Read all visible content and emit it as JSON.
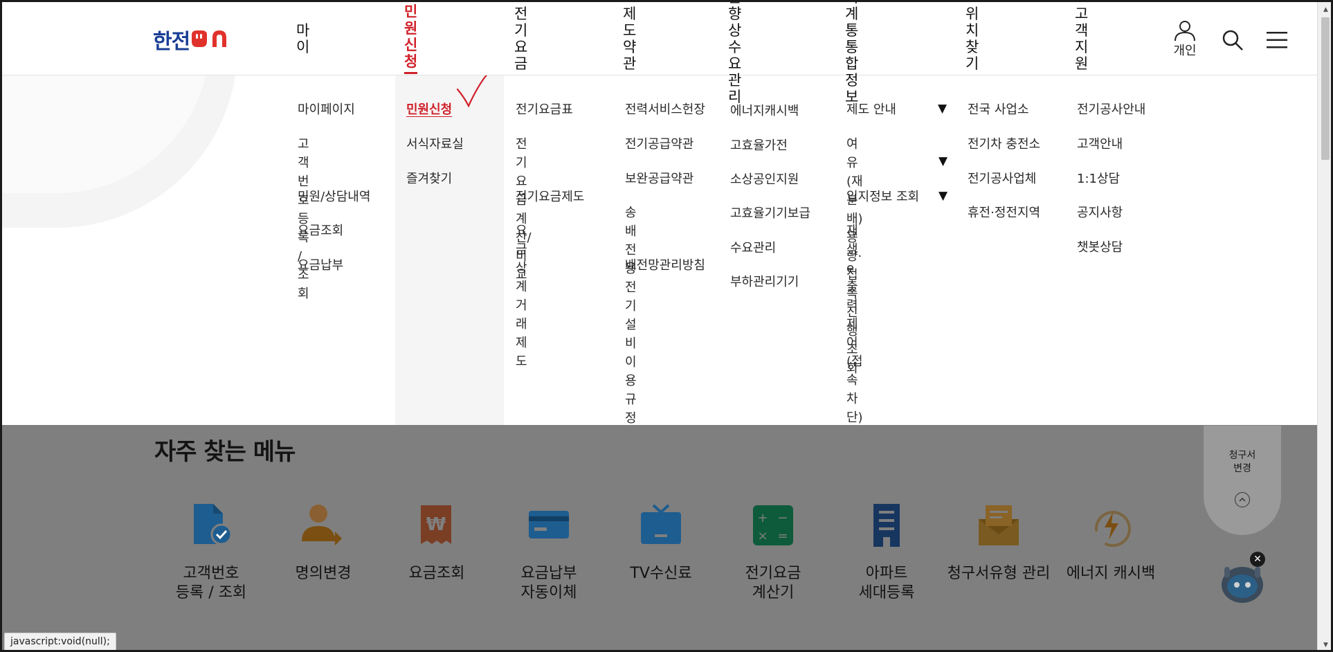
{
  "brand": {
    "logo_text": "한전",
    "logo_on": "ON",
    "colors": {
      "primary": "#1b3f95",
      "accent": "#d0212a",
      "dim": "#7f7f7f"
    }
  },
  "gnb": [
    {
      "label": "마이"
    },
    {
      "label": "민원신청",
      "active": true
    },
    {
      "label": "전기요금"
    },
    {
      "label": "제도약관"
    },
    {
      "label": "효율향상\n수요관리"
    },
    {
      "label": "전력계통\n통합정보"
    },
    {
      "label": "위치찾기"
    },
    {
      "label": "고객지원"
    }
  ],
  "util": {
    "user_label": "개인",
    "user_icon": "person-icon",
    "search_icon": "search-icon",
    "menu_icon": "hamburger-menu-icon"
  },
  "mega_menu": {
    "col_my": [
      "마이페이지",
      "고객번호\n등록 / 조회",
      "민원/상담내역",
      "요금조회",
      "요금납부"
    ],
    "col_apply": [
      "민원신청",
      "서식자료실",
      "즐겨찾기"
    ],
    "col_bill": [
      "전기요금표",
      "전기요금계산/\n비교",
      "전기요금제도",
      "요금 상계거래\n제도"
    ],
    "col_terms": [
      "전력서비스헌장",
      "전기공급약관",
      "보완공급약관",
      "송배전용 전기\n설비 이용규정",
      "배전망관리방침"
    ],
    "col_eff": [
      "에너지캐시백",
      "고효율가전",
      "소상공인지원",
      "고효율기기보급",
      "수요관리",
      "부하관리기기"
    ],
    "col_grid": [
      "제도 안내",
      "여유(재분배)용량·\n접속진행 조회",
      "입지정보 조회",
      "재생e 출력제어\n(접속차단) 현황"
    ],
    "col_loc": [
      "전국 사업소",
      "전기차 충전소",
      "전기공사업체",
      "휴전·정전지역"
    ],
    "col_support": [
      "전기공사안내",
      "고객안내",
      "1:1상담",
      "공지사항",
      "챗봇상담"
    ]
  },
  "frequent": {
    "title": "자주 찾는 메뉴",
    "items": [
      {
        "label": "고객번호\n등록 / 조회",
        "icon": "document-check-icon"
      },
      {
        "label": "명의변경",
        "icon": "person-change-icon"
      },
      {
        "label": "요금조회",
        "icon": "won-receipt-icon"
      },
      {
        "label": "요금납부\n자동이체",
        "icon": "credit-card-icon"
      },
      {
        "label": "TV수신료",
        "icon": "tv-icon"
      },
      {
        "label": "전기요금\n계산기",
        "icon": "calculator-icon"
      },
      {
        "label": "아파트\n세대등록",
        "icon": "apartment-icon"
      },
      {
        "label": "청구서유형 관리",
        "icon": "mail-bill-icon"
      },
      {
        "label": "에너지 캐시백",
        "icon": "energy-bolt-icon"
      }
    ]
  },
  "floating": {
    "label": "청구서\n변경",
    "icon": "chevron-up-icon"
  },
  "chatbot": {
    "icon": "chatbot-robot-icon",
    "close_icon": "close-icon"
  },
  "status_bar": "javascript:void(null);"
}
